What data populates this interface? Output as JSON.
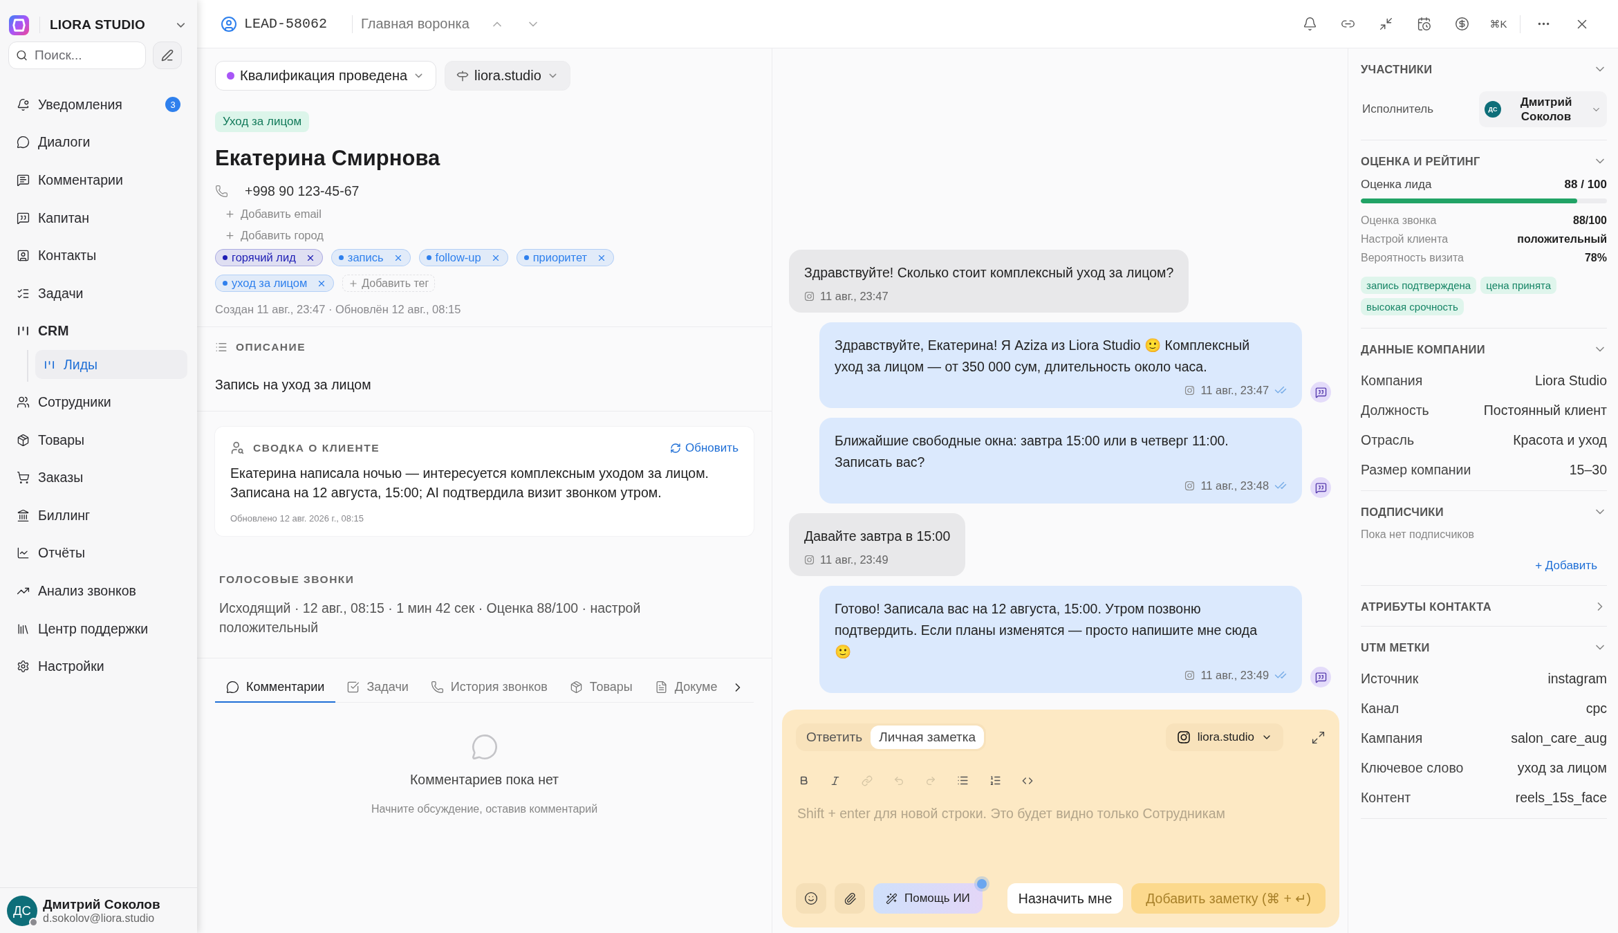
{
  "sidebar": {
    "workspace": "LIORA STUDIO",
    "search": {
      "placeholder": "Поиск..."
    },
    "items": [
      {
        "label": "Уведомления",
        "badge": "3",
        "selected": false
      },
      {
        "label": "Диалоги",
        "selected": false
      },
      {
        "label": "Комментарии",
        "selected": false
      },
      {
        "label": "Капитан",
        "selected": false
      },
      {
        "label": "Контакты",
        "selected": false
      },
      {
        "label": "Задачи",
        "selected": false
      },
      {
        "label": "CRM",
        "selected": false,
        "expanded": true,
        "children": [
          {
            "label": "Лиды",
            "selected": true
          }
        ]
      },
      {
        "label": "Сотрудники",
        "selected": false
      },
      {
        "label": "Товары",
        "selected": false
      },
      {
        "label": "Заказы",
        "selected": false
      },
      {
        "label": "Биллинг",
        "selected": false
      },
      {
        "label": "Отчёты",
        "selected": false
      },
      {
        "label": "Анализ звонков",
        "selected": false
      },
      {
        "label": "Центр поддержки",
        "selected": false
      },
      {
        "label": "Настройки",
        "selected": false
      }
    ],
    "user": {
      "initials": "ДС",
      "name": "Дмитрий Соколов",
      "email": "d.sokolov@liora.studio"
    }
  },
  "header": {
    "lead_id": "LEAD-58062",
    "pipeline": "Главная воронка",
    "shortcut": "⌘K"
  },
  "lead": {
    "stage": {
      "label": "Квалификация проведена",
      "color": "#a855f7"
    },
    "channel": "liora.studio",
    "category": "Уход за лицом",
    "name": "Екатерина Смирнова",
    "phone": "+998 90 123-45-67",
    "add_links": [
      "Добавить email",
      "Добавить город"
    ],
    "tags": [
      {
        "label": "горячий лид",
        "color": "#1e1eb4"
      },
      {
        "label": "запись",
        "color": "#2f80ed"
      },
      {
        "label": "follow-up",
        "color": "#2f80ed"
      },
      {
        "label": "приоритет",
        "color": "#2f80ed"
      },
      {
        "label": "уход за лицом",
        "color": "#2f80ed"
      }
    ],
    "add_tag": "Добавить тег",
    "meta": "Создан 11 авг., 23:47 · Обновлён 12 авг., 08:15"
  },
  "description": {
    "title": "ОПИСАНИЕ",
    "text": "Запись на уход за лицом"
  },
  "summary": {
    "title": "СВОДКА О КЛИЕНТЕ",
    "refresh": "Обновить",
    "text": "Екатерина написала ночью — интересуется комплексным уходом за лицом. Записана на 12 августа, 15:00; AI подтвердила визит звонком утром.",
    "updated": "Обновлено 12 авг. 2026 г., 08:15"
  },
  "calls": {
    "title": "ГОЛОСОВЫЕ ЗВОНКИ",
    "text": "Исходящий · 12 авг., 08:15 · 1 мин 42 сек · Оценка 88/100 · настрой положительный"
  },
  "tabs": [
    {
      "label": "Комментарии",
      "selected": true
    },
    {
      "label": "Задачи",
      "selected": false
    },
    {
      "label": "История звонков",
      "selected": false
    },
    {
      "label": "Товары",
      "selected": false
    },
    {
      "label": "Докуме",
      "selected": false
    }
  ],
  "empty_state": {
    "title": "Комментариев пока нет",
    "text": "Начните обсуждение, оставив комментарий"
  },
  "chat": {
    "messages": [
      {
        "kind": "incoming",
        "text": "Здравствуйте! Сколько стоит комплексный уход за лицом?",
        "time": "11 авг., 23:47"
      },
      {
        "kind": "outgoing",
        "text": "Здравствуйте, Екатерина! Я Aziza из Liora Studio 🙂 Комплексный уход за лицом — от 350 000 сум, длительность около часа.",
        "time": "11 авг., 23:47"
      },
      {
        "kind": "outgoing",
        "text": "Ближайшие свободные окна: завтра 15:00 или в четверг 11:00. Записать вас?",
        "time": "11 авг., 23:48"
      },
      {
        "kind": "incoming",
        "text": "Давайте завтра в 15:00",
        "time": "11 авг., 23:49"
      },
      {
        "kind": "outgoing",
        "text": "Готово! Записала вас на 12 августа, 15:00. Утром позвоню подтвердить. Если планы изменятся — просто напишите мне сюда 🙂",
        "time": "11 авг., 23:49"
      }
    ]
  },
  "composer": {
    "modes": [
      {
        "label": "Ответить",
        "selected": false
      },
      {
        "label": "Личная заметка",
        "selected": true
      }
    ],
    "account": "liora.studio",
    "placeholder": "Shift + enter для новой строки. Это будет видно только Сотрудникам",
    "ai_button": "Помощь ИИ",
    "assign_button": "Назначить мне",
    "submit": {
      "label": "Добавить заметку (⌘ + ↵)",
      "disabled": true
    }
  },
  "panel": {
    "participants": {
      "title": "УЧАСТНИКИ",
      "expanded": true,
      "role": "Исполнитель",
      "initials": "ДС",
      "name": "Дмитрий Соколов"
    },
    "rating": {
      "title": "ОЦЕНКА И РЕЙТИНГ",
      "expanded": true,
      "score_label": "Оценка лида",
      "score": "88 / 100",
      "level": 0.88,
      "rows": [
        {
          "label": "Оценка звонка",
          "value": "88/100"
        },
        {
          "label": "Настрой клиента",
          "value": "положительный"
        },
        {
          "label": "Вероятность визита",
          "value": "78%"
        }
      ],
      "chips": [
        "запись подтверждена",
        "цена принята",
        "высокая срочность"
      ]
    },
    "company": {
      "title": "ДАННЫЕ КОМПАНИИ",
      "expanded": true,
      "rows": [
        {
          "label": "Компания",
          "value": "Liora Studio"
        },
        {
          "label": "Должность",
          "value": "Постоянный клиент"
        },
        {
          "label": "Отрасль",
          "value": "Красота и уход"
        },
        {
          "label": "Размер компании",
          "value": "15–30"
        }
      ]
    },
    "subscribers": {
      "title": "ПОДПИСЧИКИ",
      "expanded": true,
      "empty": "Пока нет подписчиков",
      "add": "+ Добавить"
    },
    "attributes": {
      "title": "АТРИБУТЫ КОНТАКТА",
      "expanded": false
    },
    "utm": {
      "title": "UTM МЕТКИ",
      "expanded": true,
      "rows": [
        {
          "label": "Источник",
          "value": "instagram"
        },
        {
          "label": "Канал",
          "value": "cpc"
        },
        {
          "label": "Кампания",
          "value": "salon_care_aug"
        },
        {
          "label": "Ключевое слово",
          "value": "уход за лицом"
        },
        {
          "label": "Контент",
          "value": "reels_15s_face"
        }
      ]
    }
  }
}
